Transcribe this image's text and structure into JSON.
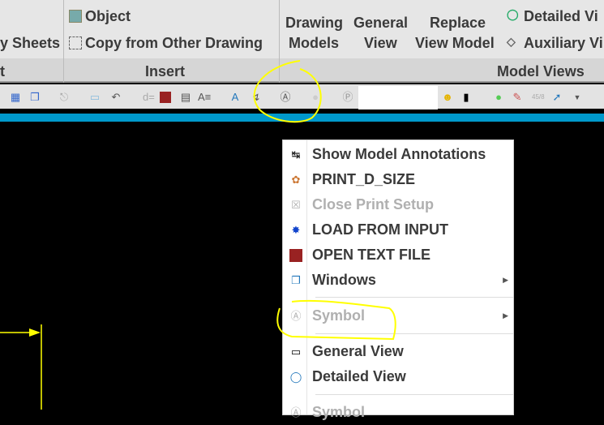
{
  "ribbon": {
    "sheets_label": "y Sheets",
    "object_label": "Object",
    "copy_label": "Copy from Other Drawing",
    "drawing_models": [
      "Drawing",
      "Models"
    ],
    "general_view": [
      "General",
      "View"
    ],
    "replace_view_model": [
      "Replace",
      "View Model"
    ],
    "detailed_view": "Detailed Vi",
    "auxiliary_view": "Auxiliary Vi",
    "groups": {
      "left": "t",
      "insert": "Insert",
      "model_views": "Model Views"
    }
  },
  "toolbar": {
    "input_value": ""
  },
  "context_menu": {
    "items": [
      {
        "label": "Show Model Annotations",
        "icon": "annotations-icon",
        "enabled": true
      },
      {
        "label": "PRINT_D_SIZE",
        "icon": "print-icon",
        "enabled": true
      },
      {
        "label": "Close Print Setup",
        "icon": "close-icon",
        "enabled": false
      },
      {
        "label": "LOAD FROM INPUT",
        "icon": "runner-icon",
        "enabled": true
      },
      {
        "label": "OPEN TEXT FILE",
        "icon": "text-file-icon",
        "enabled": true
      },
      {
        "label": "Windows",
        "icon": "windows-icon",
        "enabled": true,
        "submenu": true
      },
      {
        "label": "Symbol",
        "icon": "symbol-icon",
        "enabled": false,
        "submenu": true
      },
      {
        "label": "General View",
        "icon": "general-view-icon",
        "enabled": true
      },
      {
        "label": "Detailed View",
        "icon": "detailed-view-icon",
        "enabled": true
      },
      {
        "label": "Symbol",
        "icon": "symbol-icon",
        "enabled": false
      }
    ]
  },
  "colors": {
    "accent": "#0099cc",
    "highlight": "#ffff00"
  }
}
